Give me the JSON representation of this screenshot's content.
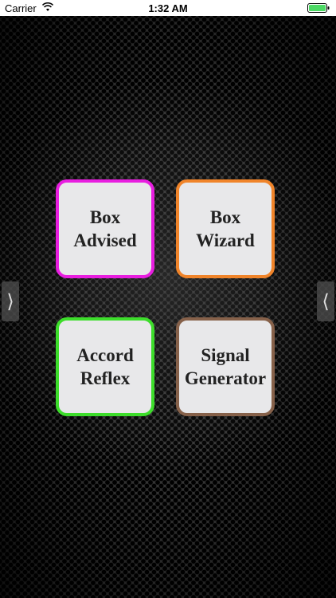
{
  "status_bar": {
    "carrier": "Carrier",
    "time": "1:32 AM",
    "icons": [
      "wifi-icon",
      "battery-icon"
    ]
  },
  "tiles": [
    {
      "line1": "Box",
      "line2": "Advised",
      "border_color": "#e81ee0"
    },
    {
      "line1": "Box",
      "line2": "Wizard",
      "border_color": "#f0842a"
    },
    {
      "line1": "Accord",
      "line2": "Reflex",
      "border_color": "#3ddd2b"
    },
    {
      "line1": "Signal",
      "line2": "Generator",
      "border_color": "#86614a"
    }
  ],
  "nav": {
    "left_arrow": "⟩",
    "right_arrow": "⟨"
  }
}
